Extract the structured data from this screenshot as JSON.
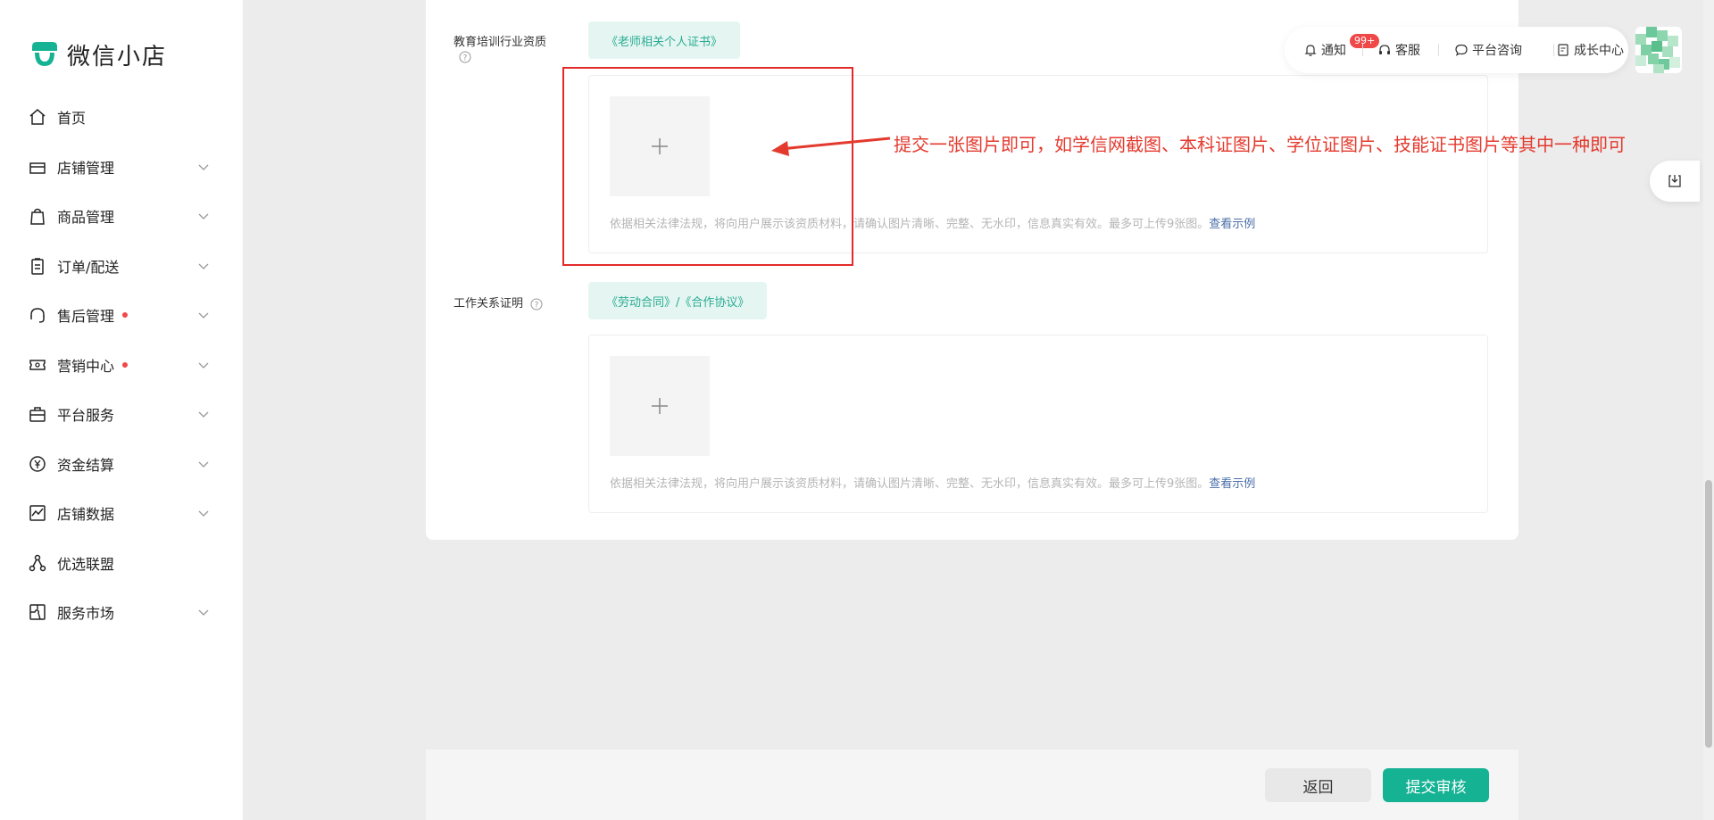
{
  "app": {
    "name": "微信小店",
    "brand_color": "#15b394"
  },
  "sidebar": {
    "items": [
      {
        "label": "首页",
        "icon": "home-icon",
        "chevron": false,
        "dot": false
      },
      {
        "label": "店铺管理",
        "icon": "store-icon",
        "chevron": true,
        "dot": false
      },
      {
        "label": "商品管理",
        "icon": "shopping-bag-icon",
        "chevron": true,
        "dot": false
      },
      {
        "label": "订单/配送",
        "icon": "clipboard-icon",
        "chevron": true,
        "dot": false
      },
      {
        "label": "售后管理",
        "icon": "headset-icon",
        "chevron": true,
        "dot": true
      },
      {
        "label": "营销中心",
        "icon": "ticket-icon",
        "chevron": true,
        "dot": true
      },
      {
        "label": "平台服务",
        "icon": "briefcase-icon",
        "chevron": true,
        "dot": false
      },
      {
        "label": "资金结算",
        "icon": "yuan-icon",
        "chevron": true,
        "dot": false
      },
      {
        "label": "店铺数据",
        "icon": "chart-icon",
        "chevron": true,
        "dot": false
      },
      {
        "label": "优选联盟",
        "icon": "network-icon",
        "chevron": false,
        "dot": false
      },
      {
        "label": "服务市场",
        "icon": "puzzle-icon",
        "chevron": true,
        "dot": false
      }
    ]
  },
  "form": {
    "edu_label": "教育培训行业资质",
    "edu_tag": "《老师相关个人证书》",
    "work_label": "工作关系证明",
    "work_tag": "《劳动合同》/《合作协议》",
    "hint_text": "依据相关法律法规，将向用户展示该资质材料，请确认图片清晰、完整、无水印，信息真实有效。最多可上传9张图。",
    "hint_link": "查看示例"
  },
  "annotation": {
    "text": "提交一张图片即可，如学信网截图、本科证图片、学位证图片、技能证书图片等其中一种即可",
    "color": "#e33a2e"
  },
  "toolbar": {
    "notify_label": "通知",
    "notify_badge": "99+",
    "service_label": "客服",
    "consult_label": "平台咨询",
    "growth_label": "成长中心"
  },
  "actions": {
    "back_label": "返回",
    "submit_label": "提交审核"
  }
}
